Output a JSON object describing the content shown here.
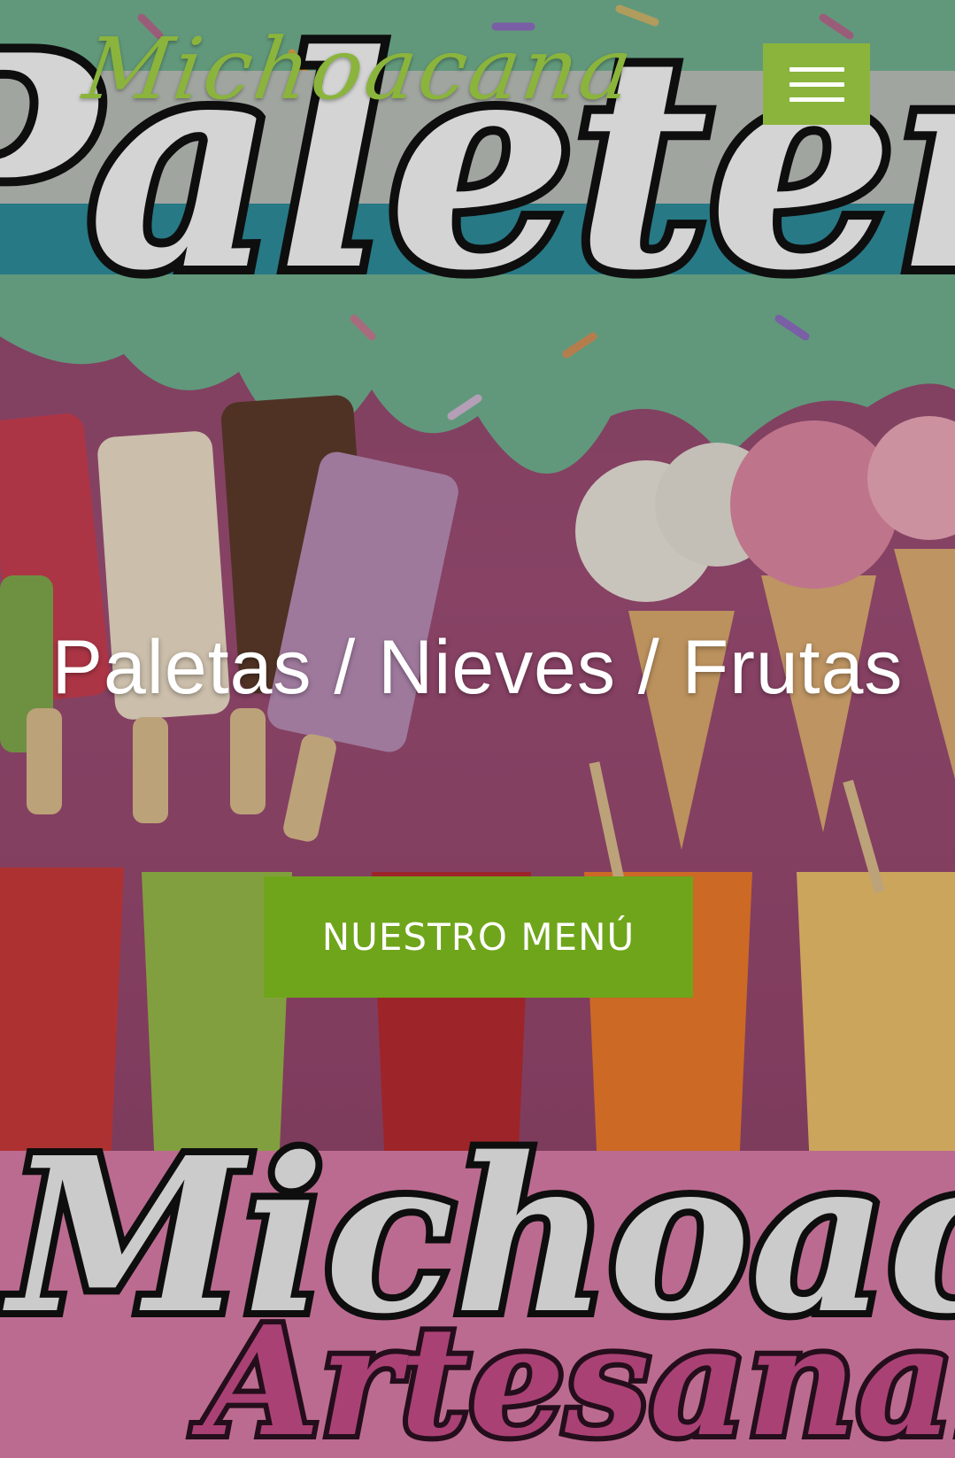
{
  "header": {
    "brand": "Michoacana",
    "menu_icon": "hamburger-icon"
  },
  "hero": {
    "tagline": "Paletas / Nieves / Frutas",
    "cta_label": "NUESTRO MENÚ",
    "background_signage": {
      "top_word": "Paleteria",
      "bottom_word": "Michoacana",
      "bottom_subword": "Artesanal"
    }
  },
  "colors": {
    "brand_green": "#8ab43c",
    "cta_green": "#6fa51b",
    "background_pink": "#9a4c72"
  }
}
